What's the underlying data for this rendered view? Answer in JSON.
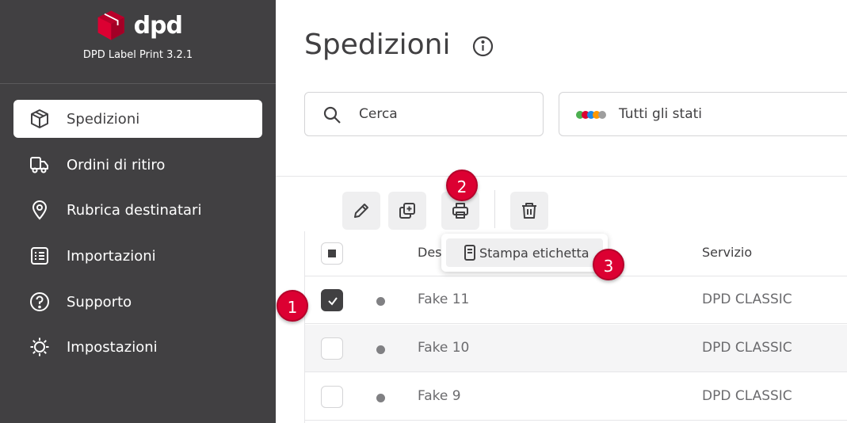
{
  "app": {
    "brand_text": "dpd",
    "version": "DPD Label Print 3.2.1"
  },
  "sidebar": {
    "items": [
      {
        "label": "Spedizioni",
        "icon": "package-icon",
        "active": true
      },
      {
        "label": "Ordini di ritiro",
        "icon": "truck-icon",
        "active": false
      },
      {
        "label": "Rubrica destinatari",
        "icon": "location-pin-icon",
        "active": false
      },
      {
        "label": "Importazioni",
        "icon": "list-icon",
        "active": false
      },
      {
        "label": "Supporto",
        "icon": "help-icon",
        "active": false
      },
      {
        "label": "Impostazioni",
        "icon": "gear-icon",
        "active": false
      }
    ]
  },
  "page": {
    "title": "Spedizioni"
  },
  "filters": {
    "search_placeholder": "Cerca",
    "status_label": "Tutti gli stati"
  },
  "toolbar": {
    "buttons": [
      "edit-icon",
      "duplicate-icon",
      "print-icon",
      "trash-icon"
    ]
  },
  "print_menu": {
    "item_label": "Stampa etichetta"
  },
  "badges": [
    "1",
    "2",
    "3"
  ],
  "table": {
    "columns": {
      "destination": "Des",
      "service": "Servizio"
    },
    "rows": [
      {
        "destination": "Fake 11",
        "service": "DPD CLASSIC",
        "checked": true
      },
      {
        "destination": "Fake 10",
        "service": "DPD CLASSIC",
        "checked": false
      },
      {
        "destination": "Fake 9",
        "service": "DPD CLASSIC",
        "checked": false
      }
    ]
  },
  "colors": {
    "sidebar_bg": "#414042",
    "brand_red": "#dc0032",
    "text_dark": "#414042",
    "button_bg": "#efeff0",
    "status_dots": [
      "#4caf50",
      "#dc0032",
      "#1e88e5",
      "#ff9800",
      "#9e9e9e"
    ]
  }
}
